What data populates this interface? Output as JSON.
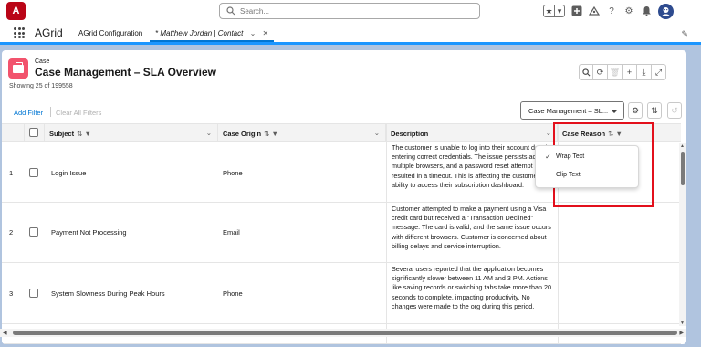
{
  "header": {
    "search_placeholder": "Search...",
    "star_icon": "★",
    "fav_caret": "▾"
  },
  "nav": {
    "app_name": "AGrid",
    "tabs": [
      {
        "label": "AGrid Configuration"
      },
      {
        "label": "* Matthew Jordan | Contact"
      }
    ]
  },
  "card": {
    "object_label": "Case",
    "title": "Case Management – SLA Overview",
    "count_text": "Showing 25 of 199558",
    "add_filter": "Add Filter",
    "clear_filters": "Clear All Filters",
    "view_name": "Case Management – SL..."
  },
  "table": {
    "columns": [
      "Subject",
      "Case Origin",
      "Description",
      "Case Reason"
    ],
    "rows": [
      {
        "num": "1",
        "subject": "Login Issue",
        "origin": "Phone",
        "description": "The customer is unable to log into their account despite entering correct credentials. The issue persists across multiple browsers, and a password reset attempt resulted in a timeout. This is affecting the customer's ability to access their subscription dashboard."
      },
      {
        "num": "2",
        "subject": "Payment Not Processing",
        "origin": "Email",
        "description": "Customer attempted to make a payment using a Visa credit card but received a \"Transaction Declined\" message. The card is valid, and the same issue occurs with different browsers. Customer is concerned about billing delays and service interruption."
      },
      {
        "num": "3",
        "subject": "System Slowness During Peak Hours",
        "origin": "Phone",
        "description": "Several users reported that the application becomes significantly slower between 11 AM and 3 PM. Actions like saving records or switching tabs take more than 20 seconds to complete, impacting productivity. No changes were made to the org during this period."
      }
    ]
  },
  "popup": {
    "items": [
      {
        "label": "Wrap Text",
        "checked": true
      },
      {
        "label": "Clip Text",
        "checked": false
      }
    ]
  },
  "colors": {
    "brand_red": "#ba0517",
    "case_pink": "#f2536d",
    "accent_blue": "#0176d3",
    "highlight_red": "#e3101c"
  }
}
